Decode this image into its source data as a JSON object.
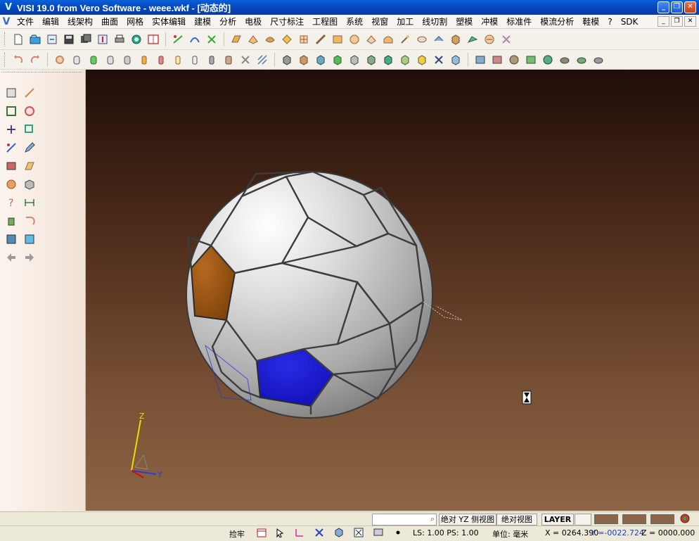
{
  "window": {
    "title": "VISI 19.0  from Vero Software - weee.wkf - [动态的]",
    "controls": [
      "_",
      "❐",
      "✕"
    ]
  },
  "menu": {
    "items": [
      "文件",
      "编辑",
      "线架构",
      "曲面",
      "网格",
      "实体编辑",
      "建模",
      "分析",
      "电极",
      "尺寸标注",
      "工程图",
      "系统",
      "视窗",
      "加工",
      "线切割",
      "塑模",
      "冲模",
      "标准件",
      "模流分析",
      "鞋模",
      "?",
      "SDK"
    ],
    "controls": [
      "_",
      "❐",
      "✕"
    ]
  },
  "colors": {
    "viewport_top": "#1f0d08",
    "viewport_bottom": "#8b6545",
    "ball_white": "#d9d9d9",
    "panel_orange": "#8a4a10",
    "panel_blue": "#1414c8",
    "axis_z": "#e8e000",
    "axis_x": "#d01010",
    "axis_y": "#2b3bd8"
  },
  "axis_labels": {
    "z": "Z",
    "y": "Y"
  },
  "status": {
    "search_placeholder": "",
    "view_buttons": [
      "绝对 YZ 侧视图",
      "绝对视图"
    ],
    "layer_label": "LAYER",
    "snap_label": "捡牢",
    "ls_ps": "LS: 1.00 PS: 1.00",
    "unit": "单位: 毫米",
    "x_coord": "X = 0264.390",
    "y_coord": "Y =-0022.724",
    "z_coord": "Z = 0000.000"
  }
}
